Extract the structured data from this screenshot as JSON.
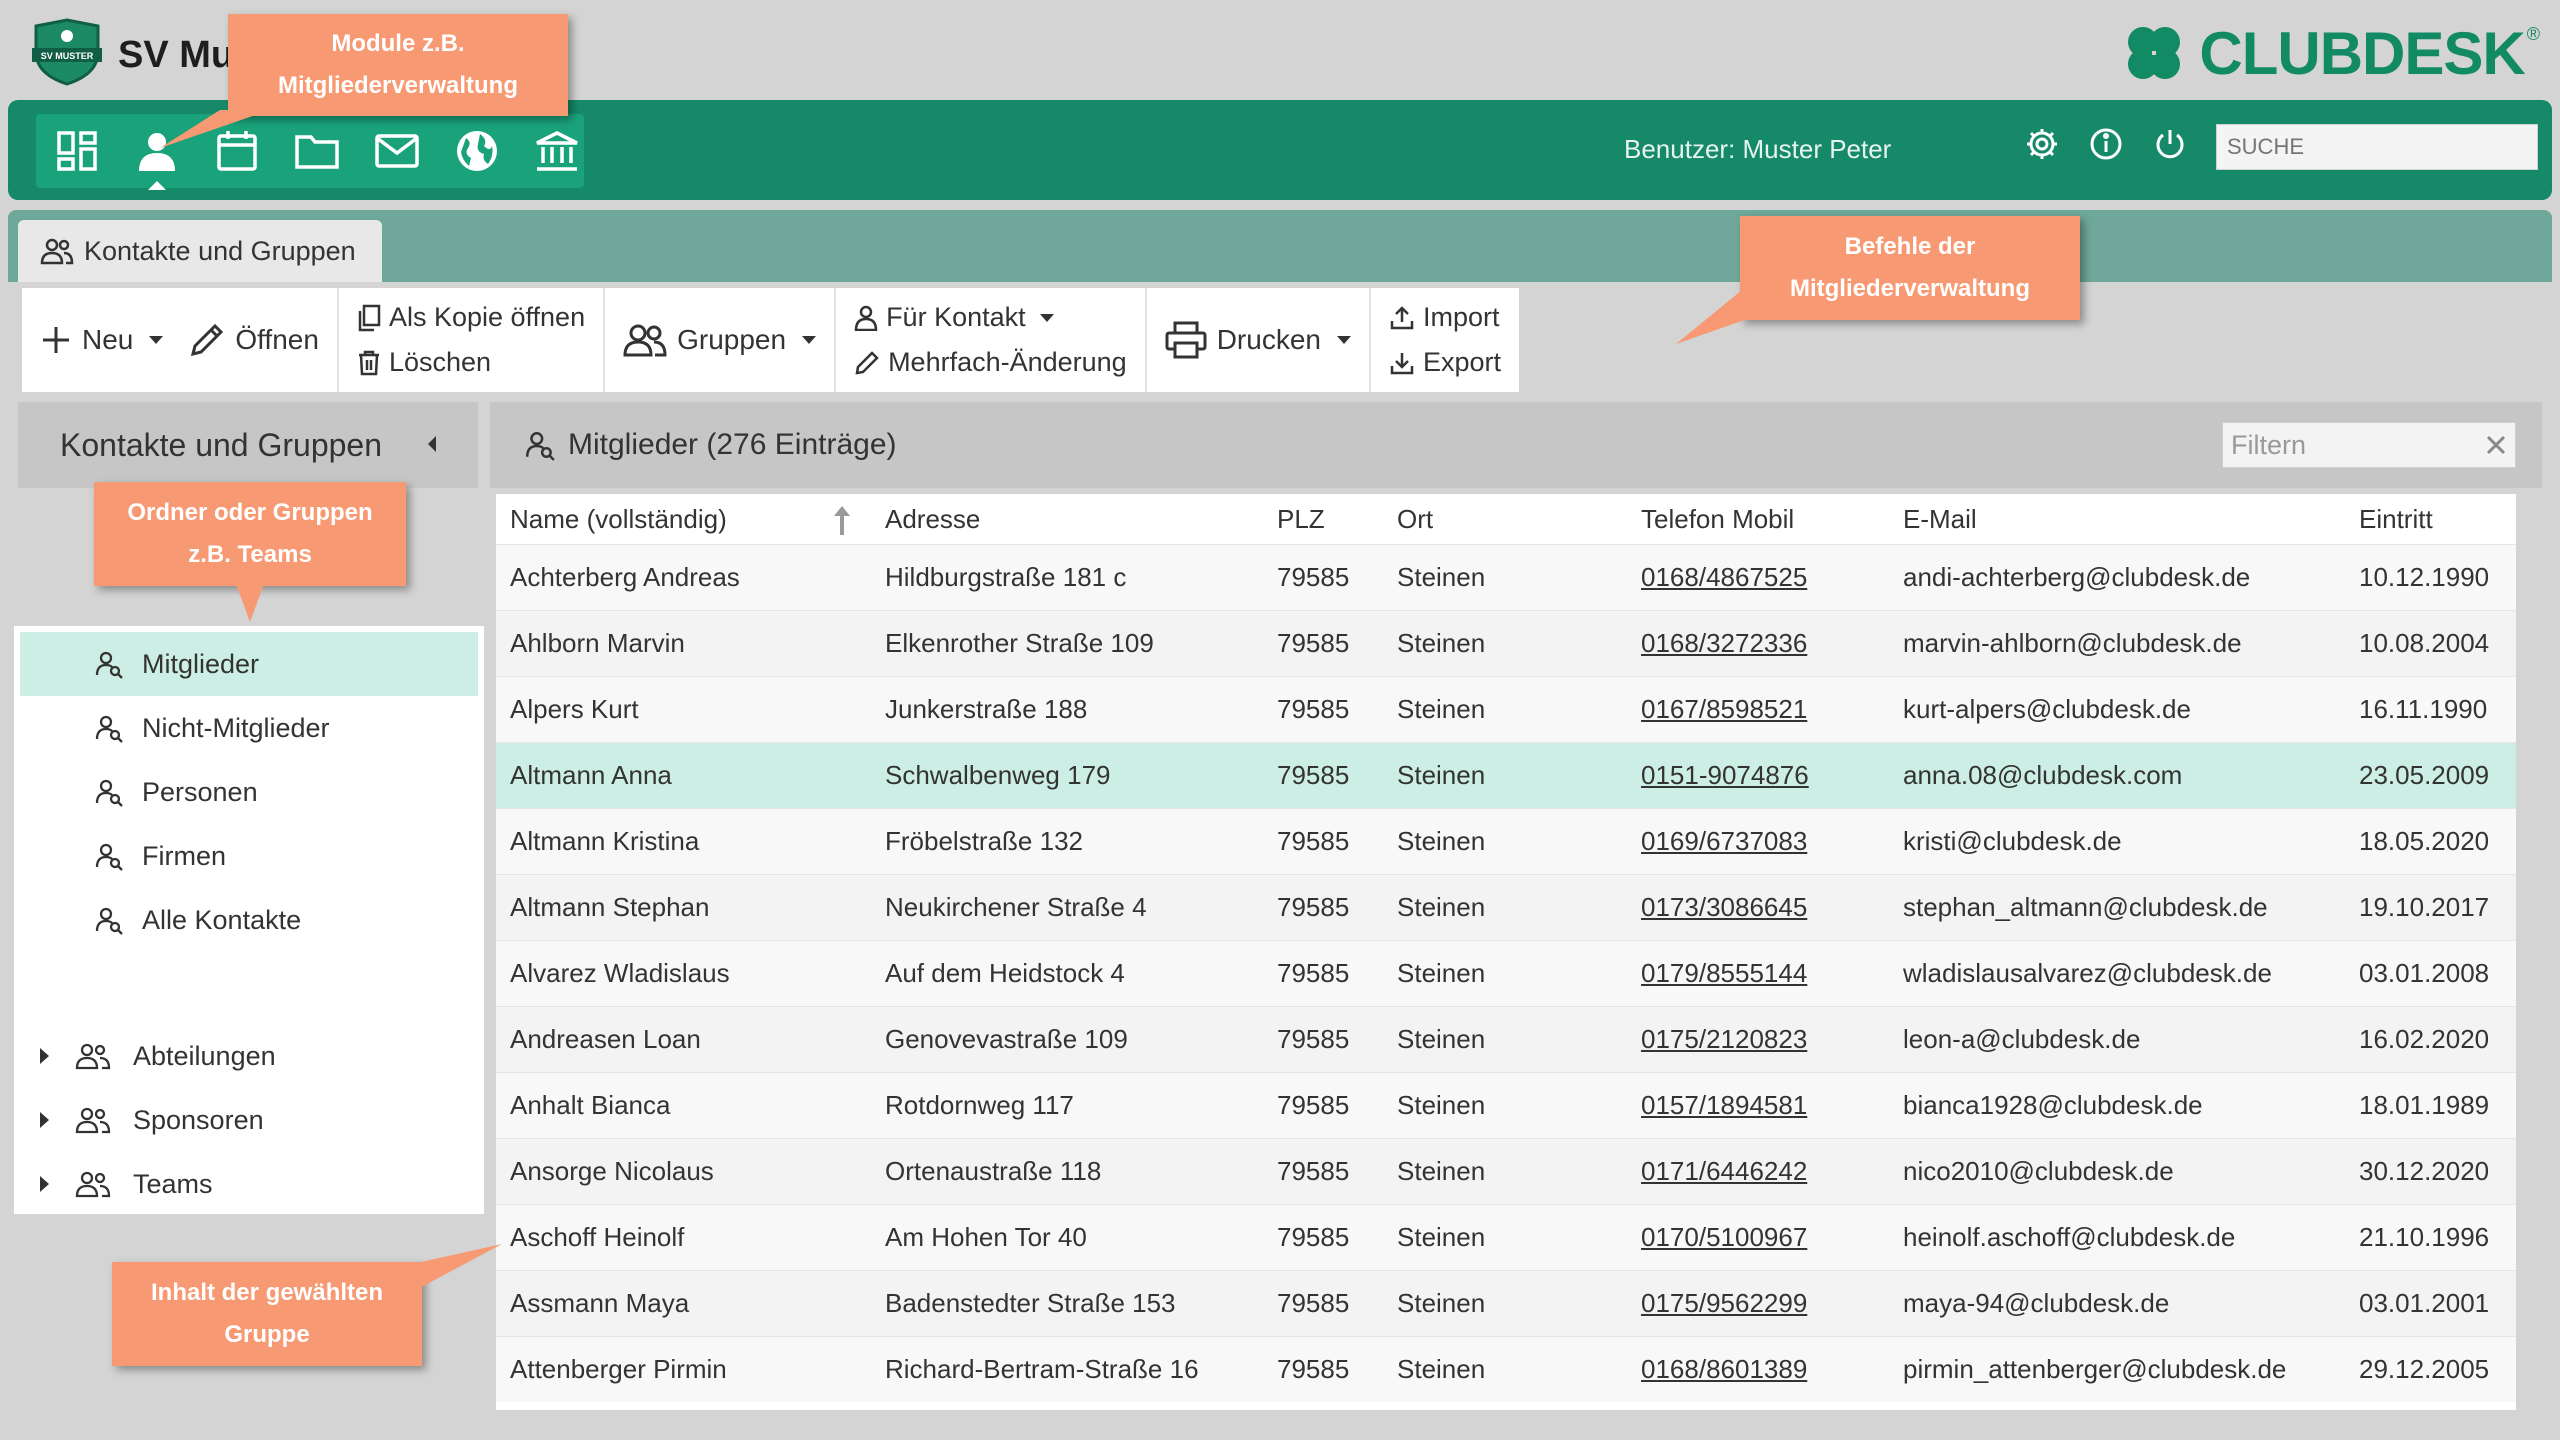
{
  "header": {
    "org_name": "SV Mu",
    "shield_text": "SV MUSTER",
    "brand": "CLUBDESK",
    "brand_reg": "®",
    "user_label": "Benutzer: Muster Peter",
    "search_placeholder": "SUCHE",
    "modules": [
      "dashboard-icon",
      "person-icon",
      "calendar-icon",
      "folder-icon",
      "mail-icon",
      "globe-icon",
      "bank-icon"
    ],
    "accent": "#168a68"
  },
  "tab": {
    "label": "Kontakte und Gruppen"
  },
  "toolbar": {
    "new": "Neu",
    "open": "Öffnen",
    "open_copy": "Als Kopie öffnen",
    "delete": "Löschen",
    "groups": "Gruppen",
    "for_contact": "Für Kontakt",
    "multi_edit": "Mehrfach-Änderung",
    "print": "Drucken",
    "import": "Import",
    "export": "Export"
  },
  "sidebar": {
    "title": "Kontakte und Gruppen",
    "items": [
      "Mitglieder",
      "Nicht-Mitglieder",
      "Personen",
      "Firmen",
      "Alle Kontakte"
    ],
    "groups": [
      "Abteilungen",
      "Sponsoren",
      "Teams"
    ]
  },
  "main": {
    "title": "Mitglieder (276 Einträge)",
    "filter_placeholder": "Filtern",
    "columns": [
      "Name (vollständig)",
      "Adresse",
      "PLZ",
      "Ort",
      "Telefon Mobil",
      "E-Mail",
      "Eintritt"
    ],
    "rows": [
      [
        "Achterberg Andreas",
        "Hildburgstraße 181 c",
        "79585",
        "Steinen",
        "0168/4867525",
        "andi-achterberg@clubdesk.de",
        "10.12.1990"
      ],
      [
        "Ahlborn Marvin",
        "Elkenrother Straße 109",
        "79585",
        "Steinen",
        "0168/3272336",
        "marvin-ahlborn@clubdesk.de",
        "10.08.2004"
      ],
      [
        "Alpers Kurt",
        "Junkerstraße 188",
        "79585",
        "Steinen",
        "0167/8598521",
        "kurt-alpers@clubdesk.de",
        "16.11.1990"
      ],
      [
        "Altmann Anna",
        "Schwalbenweg 179",
        "79585",
        "Steinen",
        "0151-9074876",
        "anna.08@clubdesk.com",
        "23.05.2009"
      ],
      [
        "Altmann Kristina",
        "Fröbelstraße 132",
        "79585",
        "Steinen",
        "0169/6737083",
        "kristi@clubdesk.de",
        "18.05.2020"
      ],
      [
        "Altmann Stephan",
        "Neukirchener Straße 4",
        "79585",
        "Steinen",
        "0173/3086645",
        "stephan_altmann@clubdesk.de",
        "19.10.2017"
      ],
      [
        "Alvarez Wladislaus",
        "Auf dem Heidstock 4",
        "79585",
        "Steinen",
        "0179/8555144",
        "wladislausalvarez@clubdesk.de",
        "03.01.2008"
      ],
      [
        "Andreasen Loan",
        "Genovevastraße 109",
        "79585",
        "Steinen",
        "0175/2120823",
        "leon-a@clubdesk.de",
        "16.02.2020"
      ],
      [
        "Anhalt Bianca",
        "Rotdornweg 117",
        "79585",
        "Steinen",
        "0157/1894581",
        "bianca1928@clubdesk.de",
        "18.01.1989"
      ],
      [
        "Ansorge Nicolaus",
        "Ortenaustraße 118",
        "79585",
        "Steinen",
        "0171/6446242",
        "nico2010@clubdesk.de",
        "30.12.2020"
      ],
      [
        "Aschoff Heinolf",
        "Am Hohen Tor 40",
        "79585",
        "Steinen",
        "0170/5100967",
        "heinolf.aschoff@clubdesk.de",
        "21.10.1996"
      ],
      [
        "Assmann Maya",
        "Badenstedter Straße 153",
        "79585",
        "Steinen",
        "0175/9562299",
        "maya-94@clubdesk.de",
        "03.01.2001"
      ],
      [
        "Attenberger Pirmin",
        "Richard-Bertram-Straße 16",
        "79585",
        "Steinen",
        "0168/8601389",
        "pirmin_attenberger@clubdesk.de",
        "29.12.2005"
      ]
    ]
  },
  "callouts": {
    "modules_1": "Module z.B.",
    "modules_2": "Mitgliederverwaltung",
    "commands_1": "Befehle der",
    "commands_2": "Mitgliederverwaltung",
    "folders_1": "Ordner oder Gruppen",
    "folders_2": "z.B. Teams",
    "content_1": "Inhalt der gewählten",
    "content_2": "Gruppe",
    "color": "#f79a73"
  }
}
